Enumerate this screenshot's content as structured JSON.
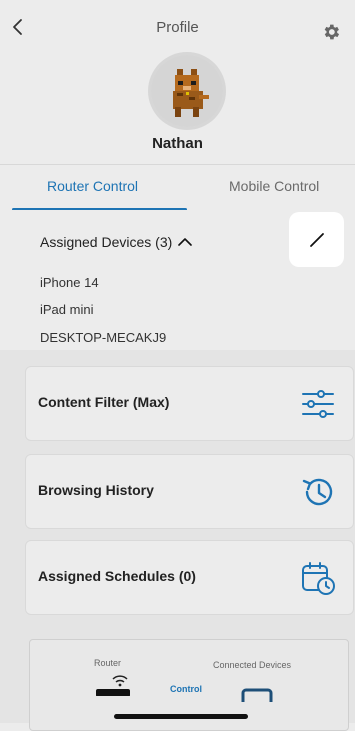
{
  "header": {
    "title": "Profile",
    "profile_name": "Nathan"
  },
  "tabs": [
    {
      "label": "Router Control",
      "active": true
    },
    {
      "label": "Mobile Control",
      "active": false
    }
  ],
  "devices": {
    "title": "Assigned Devices (3)",
    "items": [
      "iPhone 14",
      "iPad mini",
      "DESKTOP-MECAKJ9"
    ]
  },
  "cards": [
    {
      "label": "Content Filter (Max)",
      "icon": "sliders-icon"
    },
    {
      "label": "Browsing History",
      "icon": "history-icon"
    },
    {
      "label": "Assigned Schedules (0)",
      "icon": "calendar-clock-icon"
    }
  ],
  "bottom_panel": {
    "router_label": "Router",
    "connected_label": "Connected Devices",
    "control_label": "Control"
  },
  "colors": {
    "accent": "#1e74b4",
    "background": "#ececec"
  }
}
